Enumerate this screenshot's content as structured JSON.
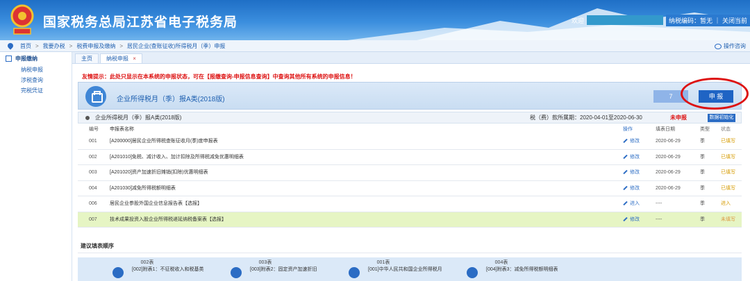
{
  "header": {
    "title": "国家税务总局江苏省电子税务局",
    "welcome": "欢迎",
    "user_meta": "纳税编码：暂无 ｜ 关闭当前"
  },
  "nav": {
    "crumbs": [
      "首页",
      "我要办税",
      "税费申报及缴纳",
      "居民企业(查账征收)所得税月（季）申报"
    ],
    "help": "操作咨询"
  },
  "sidebar": {
    "head": "申报缴纳",
    "items": [
      "纳税申报",
      "涉税查询",
      "完税凭证"
    ]
  },
  "tabs": [
    {
      "label": "主页"
    },
    {
      "label": "纳税申报",
      "close": "×"
    }
  ],
  "notice": "友情提示：此处只显示在本系统的申报状态，可在【报缴查询-申报信息查询】中查询其他所有系统的申报信息！",
  "form": {
    "title": "企业所得税月（季）报A类(2018版)",
    "count_label": "7",
    "declare_label": "申 报"
  },
  "summary": {
    "name": "企业所得税月（季）报A类(2018版)",
    "period": "税（费）款所属期：2020-04-01至2020-06-30",
    "status": "未申报",
    "init_label": "数据初始化"
  },
  "table": {
    "headers": {
      "no": "编号",
      "name": "申报表名称",
      "op": "操作",
      "date": "填表日期",
      "type": "类型",
      "status": "状态"
    },
    "rows": [
      {
        "no": "001",
        "name": "[A200000]居民企业所得税查账征收月(季)度申报表",
        "op": "修改",
        "date": "2020-06-29",
        "type": "季",
        "status": "已填写"
      },
      {
        "no": "002",
        "name": "[A201010]免税、减计收入、加计扣除及所得税减免优惠明细表",
        "op": "修改",
        "date": "2020-06-29",
        "type": "季",
        "status": "已填写"
      },
      {
        "no": "003",
        "name": "[A201020]资产加速折旧摊销(扣除)优惠明细表",
        "op": "修改",
        "date": "2020-06-29",
        "type": "季",
        "status": "已填写"
      },
      {
        "no": "004",
        "name": "[A201030]减免所得税额明细表",
        "op": "修改",
        "date": "2020-06-29",
        "type": "季",
        "status": "已填写"
      },
      {
        "no": "006",
        "name": "居民企业参股外国企业信息报告表【选报】",
        "op": "进入",
        "date": "----",
        "type": "季",
        "status": "进入"
      },
      {
        "no": "007",
        "name": "技术成果投资入股企业所得税递延纳税备案表【选报】",
        "op": "修改",
        "date": "----",
        "type": "季",
        "status": "未填写"
      }
    ]
  },
  "suggest": {
    "title": "建议填表顺序",
    "steps": [
      {
        "code": "002表",
        "desc": "[002]附表1：不征税收入和税基类"
      },
      {
        "code": "003表",
        "desc": "[003]附表2：固定资产加速折旧"
      },
      {
        "code": "001表",
        "desc": "[001]中华人民共和国企业所得税月"
      },
      {
        "code": "004表",
        "desc": "[004]附表3：减免所得税额明细表"
      }
    ]
  }
}
